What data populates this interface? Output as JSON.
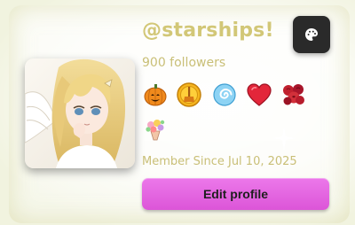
{
  "profile": {
    "username": "@starships!",
    "followers": "900 followers",
    "member_since": "Member Since Jul 10, 2025",
    "edit_label": "Edit profile"
  },
  "palette_button": {
    "icon": "palette-icon"
  },
  "avatar": {
    "icon": "anime-avatar-image"
  },
  "badges": [
    {
      "name": "pumpkin-badge"
    },
    {
      "name": "broom-coin-badge"
    },
    {
      "name": "swirl-badge"
    },
    {
      "name": "heart-badge"
    },
    {
      "name": "roses-badge"
    },
    {
      "name": "flower-bouquet-badge"
    }
  ],
  "colors": {
    "accent_text": "#d2c777",
    "edit_button": "#e46ae1",
    "palette_button_bg": "#2a2a2a",
    "background": "#f1f3df"
  }
}
